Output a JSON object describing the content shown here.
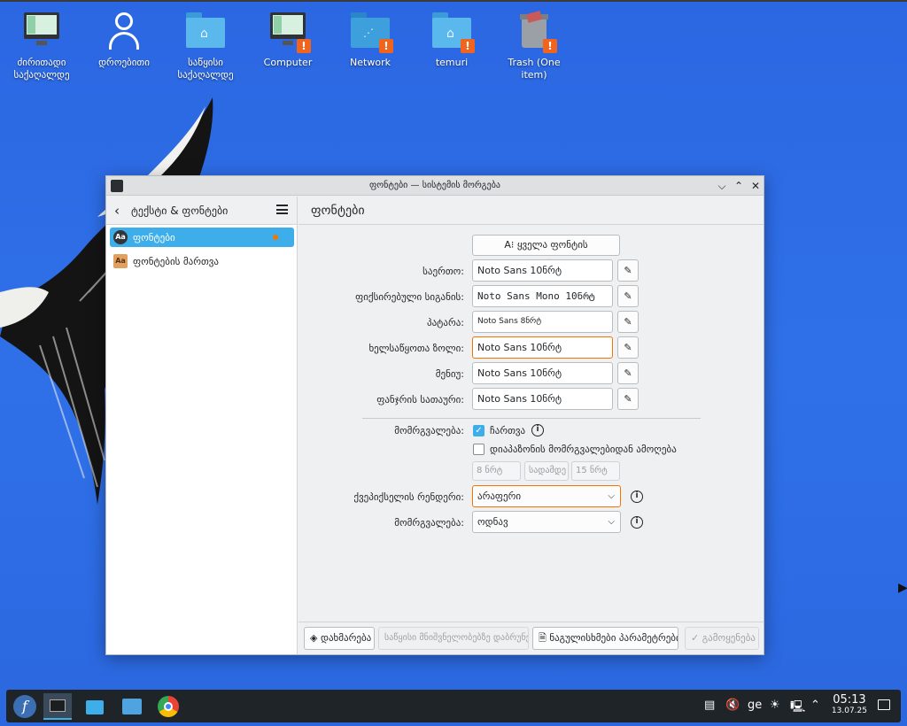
{
  "desktop": {
    "icons": [
      {
        "label": "ძირითადი საქაღალდე"
      },
      {
        "label": "დროებითი"
      },
      {
        "label": "საწყისი საქაღალდე"
      },
      {
        "label": "Computer"
      },
      {
        "label": "Network"
      },
      {
        "label": "temuri"
      },
      {
        "label": "Trash (One item)"
      }
    ]
  },
  "window": {
    "title": "ფონტები — სისტემის მორგება",
    "minimize_glyph": "⌵",
    "maximize_glyph": "⌃",
    "close_glyph": "✕"
  },
  "sidebar": {
    "back_glyph": "‹",
    "title": "ტექსტი & ფონტები",
    "items": [
      {
        "label": "ფონტები",
        "icon": "Aa"
      },
      {
        "label": "ფონტების მართვა",
        "icon": "Aa"
      }
    ]
  },
  "main": {
    "title": "ფონტები",
    "adjust_all_button": "A⁝  ყველა ფონტის გასწორება...",
    "fonts": [
      {
        "label": "საერთო:",
        "value": "Noto Sans 10ნრტ"
      },
      {
        "label": "ფიქსირებული სიგანის:",
        "value": "Noto Sans Mono 10ნრტ"
      },
      {
        "label": "პატარა:",
        "value": "Noto Sans 8ნრტ"
      },
      {
        "label": "ხელსაწყოთა ზოლი:",
        "value": "Noto Sans 10ნრტ"
      },
      {
        "label": "მენიუ:",
        "value": "Noto Sans 10ნრტ"
      },
      {
        "label": "ფანჯრის სათაური:",
        "value": "Noto Sans 10ნრტ"
      }
    ],
    "pen_glyph": "✎",
    "antialias_label": "მომრგვალება:",
    "antialias_check_label": "ჩართვა",
    "exclude_label": "დიაპაზონის მომრგვალებიდან ამოღება",
    "range_from": "8 ნრტ",
    "range_to_label": "სადამდე",
    "range_to": "15 ნრტ",
    "subpixel_label": "ქვეპიქსელის რენდერი:",
    "subpixel_value": "არაფერი",
    "hinting_label": "მომრგვალება:",
    "hinting_value": "ოდნავ",
    "info_glyph": "i",
    "check_glyph": "✓"
  },
  "footer": {
    "help": "დახმარება",
    "reset": "საწყისი მნიშვნელობებზე დაბრუნება",
    "defaults": "ნაგულისხმები პარამეტრები",
    "apply": "გამოყენება"
  },
  "taskbar": {
    "keyboard_layout": "ge",
    "time": "05:13",
    "date": "13.07.25"
  },
  "colors": {
    "desktop": "#2f6fe6",
    "accent": "#3daee9",
    "focus": "#f67400",
    "warning": "#f0641e"
  }
}
